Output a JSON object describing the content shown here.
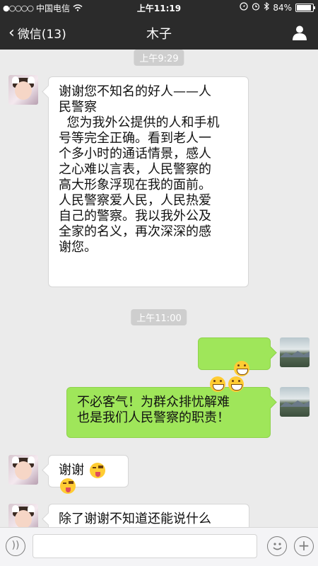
{
  "status": {
    "carrier": "中国电信",
    "time": "上午11:19",
    "battery": "84%",
    "battery_level": 0.84
  },
  "nav": {
    "back_label": "微信(13)",
    "title": "木子"
  },
  "messages": [
    {
      "kind": "time",
      "text": "上午9:29"
    },
    {
      "kind": "in",
      "text": "谢谢您不知名的好人——人\n民警察\n  您为我外公提供的人和手机\n号等完全正确。看到老人一\n个多小时的通话情景，感人\n之心难以言表，人民警察的\n高大形象浮现在我的面前。\n人民警察爱人民，人民热爱\n自己的警察。我以我外公及\n全家的名义，再次深深的感\n谢您。"
    },
    {
      "kind": "time",
      "text": "上午11:00"
    },
    {
      "kind": "out",
      "emoji": "grinning-face-emoji x3"
    },
    {
      "kind": "out",
      "text": "不必客气！为群众排忧解难\n也是我们人民警察的职责！"
    },
    {
      "kind": "in",
      "text": "谢谢",
      "emoji": "winking-tongue-emoji x2"
    },
    {
      "kind": "in",
      "text": "除了谢谢不知道还能说什么"
    }
  ],
  "icons": {
    "back": "chevron-left-icon",
    "profile": "person-icon",
    "voice": "voice-icon",
    "emoji": "emoji-icon",
    "plus": "plus-icon"
  },
  "colors": {
    "nav_bg": "#2b2b2b",
    "chat_bg": "#ebebeb",
    "out_bubble": "#9fe65a",
    "in_bubble": "#ffffff"
  }
}
